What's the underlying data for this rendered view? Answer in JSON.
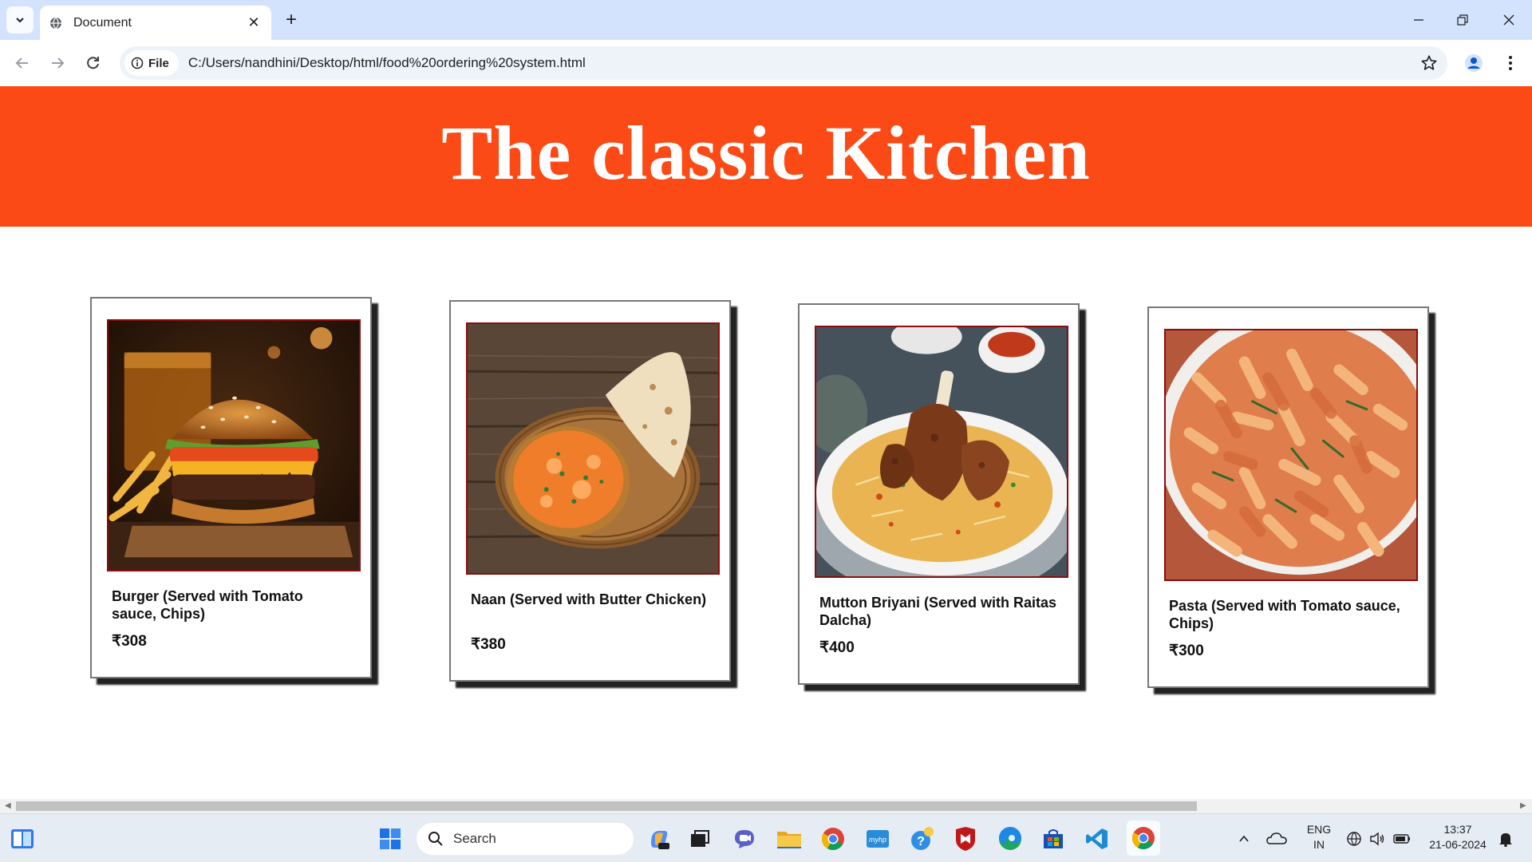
{
  "browser": {
    "tab_title": "Document",
    "url_chip": "File",
    "url": "C:/Users/nandhini/Desktop/html/food%20ordering%20system.html"
  },
  "page": {
    "heading": "The classic Kitchen",
    "items": [
      {
        "name": "Burger (Served with Tomato sauce, Chips)",
        "price": "₹308"
      },
      {
        "name": "Naan (Served with Butter Chicken)",
        "price": "₹380"
      },
      {
        "name": "Mutton Briyani (Served with Raitas Dalcha)",
        "price": "₹400"
      },
      {
        "name": "Pasta (Served with Tomato sauce, Chips)",
        "price": "₹300"
      }
    ],
    "colors": {
      "banner": "#fb4a15",
      "image_border": "#8b0d0d"
    }
  },
  "taskbar": {
    "search_placeholder": "Search",
    "lang_top": "ENG",
    "lang_bottom": "IN",
    "time": "13:37",
    "date": "21-06-2024"
  }
}
